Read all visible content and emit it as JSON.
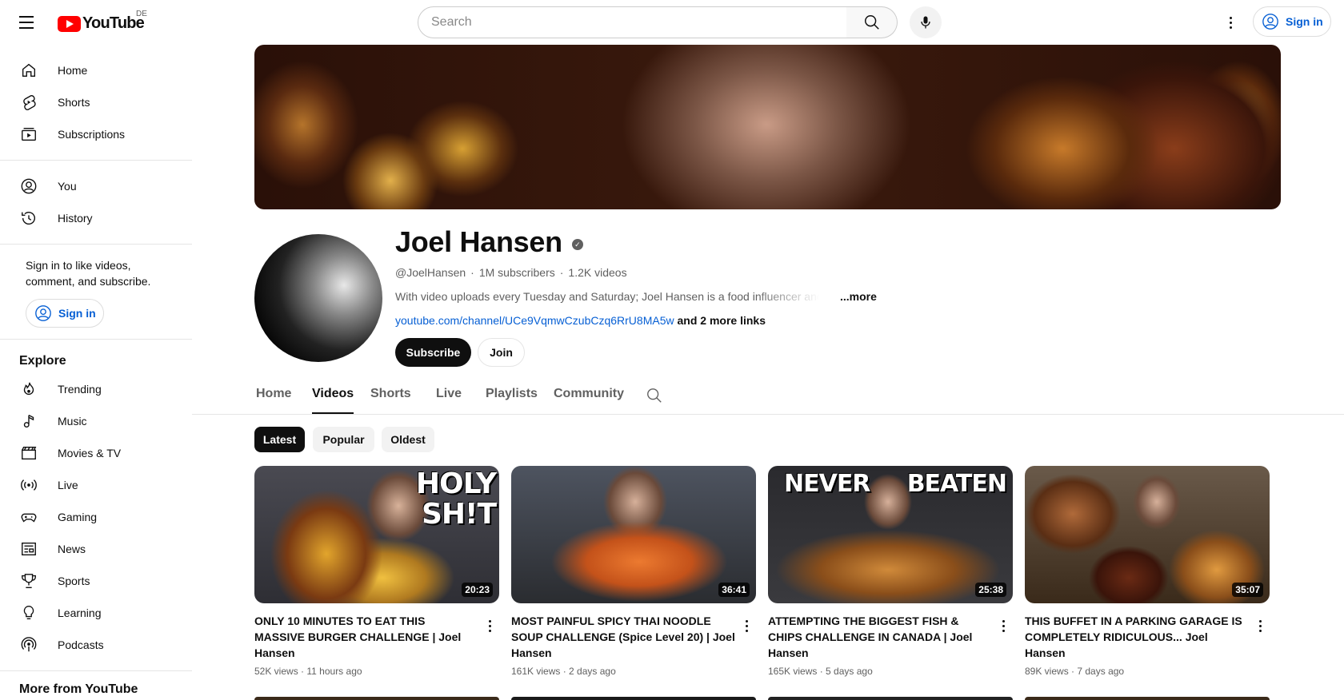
{
  "header": {
    "logo_text": "YouTube",
    "country": "DE",
    "search_placeholder": "Search",
    "signin_label": "Sign in"
  },
  "sidebar": {
    "primary": [
      {
        "label": "Home",
        "icon": "home-icon"
      },
      {
        "label": "Shorts",
        "icon": "shorts-icon"
      },
      {
        "label": "Subscriptions",
        "icon": "subscriptions-icon"
      }
    ],
    "you": [
      {
        "label": "You",
        "icon": "you-icon"
      },
      {
        "label": "History",
        "icon": "history-icon"
      }
    ],
    "signin_prompt": "Sign in to like videos, comment, and subscribe.",
    "signin_label": "Sign in",
    "explore_title": "Explore",
    "explore": [
      {
        "label": "Trending",
        "icon": "trending-icon"
      },
      {
        "label": "Music",
        "icon": "music-icon"
      },
      {
        "label": "Movies & TV",
        "icon": "movies-icon"
      },
      {
        "label": "Live",
        "icon": "live-icon"
      },
      {
        "label": "Gaming",
        "icon": "gaming-icon"
      },
      {
        "label": "News",
        "icon": "news-icon"
      },
      {
        "label": "Sports",
        "icon": "sports-icon"
      },
      {
        "label": "Learning",
        "icon": "learning-icon"
      },
      {
        "label": "Podcasts",
        "icon": "podcasts-icon"
      }
    ],
    "more_title": "More from YouTube"
  },
  "channel": {
    "name": "Joel Hansen",
    "handle": "@JoelHansen",
    "subscribers": "1M subscribers",
    "videos": "1.2K videos",
    "description": "With video uploads every Tuesday and Saturday; Joel Hansen is a food influencer and",
    "more_label": "...more",
    "link": "youtube.com/channel/UCe9VqmwCzubCzq6RrU8MA5w",
    "more_links": "and 2 more links",
    "subscribe_label": "Subscribe",
    "join_label": "Join"
  },
  "tabs": [
    "Home",
    "Videos",
    "Shorts",
    "Live",
    "Playlists",
    "Community"
  ],
  "active_tab": "Videos",
  "chips": [
    "Latest",
    "Popular",
    "Oldest"
  ],
  "active_chip": "Latest",
  "videos": [
    {
      "title": "ONLY 10 MINUTES TO EAT THIS MASSIVE BURGER CHALLENGE | Joel Hansen",
      "views": "52K views",
      "age": "11 hours ago",
      "duration": "20:23",
      "thumb_text": "HOLY\nSH!T"
    },
    {
      "title": "MOST PAINFUL SPICY THAI NOODLE SOUP CHALLENGE (Spice Level 20) | Joel Hansen",
      "views": "161K views",
      "age": "2 days ago",
      "duration": "36:41",
      "thumb_text": ""
    },
    {
      "title": "ATTEMPTING THE BIGGEST FISH & CHIPS CHALLENGE IN CANADA | Joel Hansen",
      "views": "165K views",
      "age": "5 days ago",
      "duration": "25:38",
      "thumb_text_left": "NEVER",
      "thumb_text_right": "BEATEN"
    },
    {
      "title": "THIS BUFFET IN A PARKING GARAGE IS COMPLETELY RIDICULOUS... Joel Hansen",
      "views": "89K views",
      "age": "7 days ago",
      "duration": "35:07",
      "thumb_text": ""
    }
  ],
  "colors": {
    "brand_red": "#ff0000",
    "link_blue": "#065fd4",
    "text_primary": "#0f0f0f",
    "text_secondary": "#606060"
  }
}
